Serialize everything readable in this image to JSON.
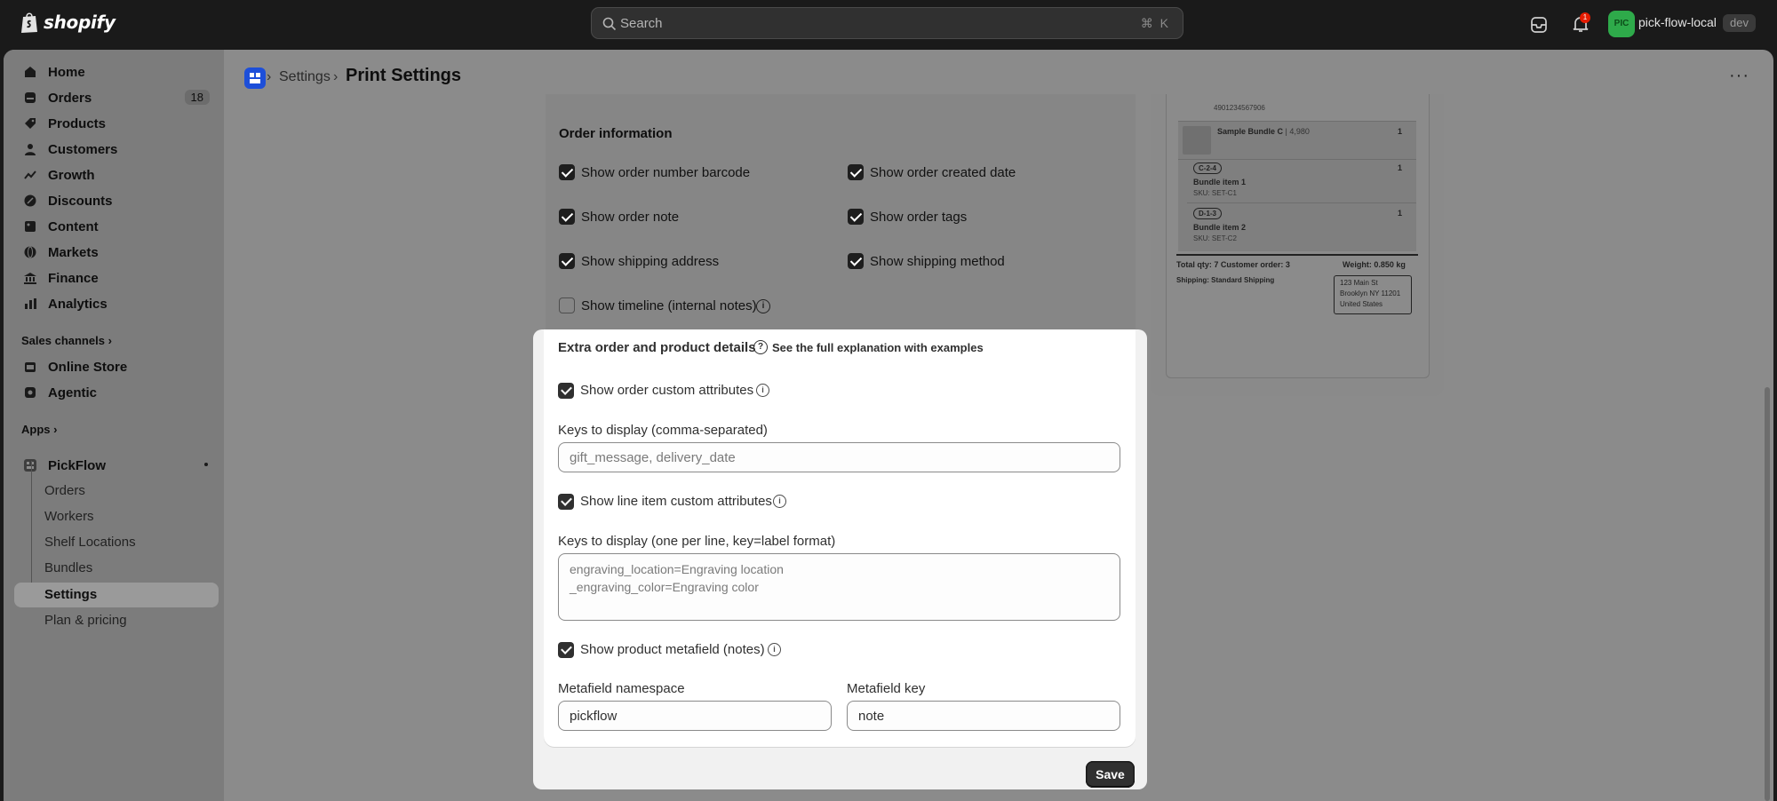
{
  "topbar": {
    "brand": "shopify",
    "search_placeholder": "Search",
    "shortcut": "⌘ K",
    "notification_count": "1",
    "avatar_initials": "PIC",
    "store_name": "pick-flow-local",
    "env_badge": "dev"
  },
  "sidebar": {
    "items": [
      {
        "label": "Home",
        "icon": "home-icon"
      },
      {
        "label": "Orders",
        "icon": "orders-icon",
        "count": "18"
      },
      {
        "label": "Products",
        "icon": "tag-icon"
      },
      {
        "label": "Customers",
        "icon": "person-icon"
      },
      {
        "label": "Growth",
        "icon": "growth-icon"
      },
      {
        "label": "Discounts",
        "icon": "discount-icon"
      },
      {
        "label": "Content",
        "icon": "content-icon"
      },
      {
        "label": "Markets",
        "icon": "globe-icon"
      },
      {
        "label": "Finance",
        "icon": "bank-icon"
      },
      {
        "label": "Analytics",
        "icon": "chart-icon"
      }
    ],
    "sales_channels_label": "Sales channels",
    "channels": [
      {
        "label": "Online Store",
        "icon": "store-icon"
      },
      {
        "label": "Agentic",
        "icon": "agentic-icon"
      }
    ],
    "apps_label": "Apps",
    "app_name": "PickFlow",
    "app_sub_items": [
      "Orders",
      "Workers",
      "Shelf Locations",
      "Bundles",
      "Settings",
      "Plan & pricing"
    ]
  },
  "breadcrumb": {
    "parent": "Settings",
    "current": "Print Settings"
  },
  "order_info": {
    "title": "Order information",
    "options": [
      {
        "label": "Show order number barcode",
        "checked": true
      },
      {
        "label": "Show order created date",
        "checked": true
      },
      {
        "label": "Show order note",
        "checked": true
      },
      {
        "label": "Show order tags",
        "checked": true
      },
      {
        "label": "Show shipping address",
        "checked": true
      },
      {
        "label": "Show shipping method",
        "checked": true
      },
      {
        "label": "Show timeline (internal notes)",
        "checked": false
      }
    ]
  },
  "extra": {
    "title": "Extra order and product details",
    "help_link": "See the full explanation with examples",
    "order_custom_attr_label": "Show order custom attributes",
    "keys_label": "Keys to display (comma-separated)",
    "keys_placeholder": "gift_message, delivery_date",
    "line_item_attr_label": "Show line item custom attributes",
    "line_keys_label": "Keys to display (one per line, key=label format)",
    "line_keys_line1": "engraving_location=Engraving location",
    "line_keys_line2": "_engraving_color=Engraving color",
    "metafield_label": "Show product metafield (notes)",
    "namespace_label": "Metafield namespace",
    "namespace_value": "pickflow",
    "key_label": "Metafield key",
    "key_value": "note",
    "save_label": "Save"
  },
  "preview": {
    "barcode_text": "4901234567906",
    "bundle_name": "Sample Bundle C",
    "bundle_price": "4,980",
    "bundle_qty": "1",
    "item1_loc": "C-2-4",
    "item1_name": "Bundle item 1",
    "item1_sku": "SKU: SET-C1",
    "item1_qty": "1",
    "item2_loc": "D-1-3",
    "item2_name": "Bundle item 2",
    "item2_sku": "SKU: SET-C2",
    "item2_qty": "1",
    "totals": "Total qty: 7 Customer order: 3",
    "weight": "Weight: 0.850 kg",
    "shipping": "Shipping: Standard Shipping",
    "addr1": "123 Main St",
    "addr2": "Brooklyn NY 11201",
    "addr3": "United States"
  }
}
